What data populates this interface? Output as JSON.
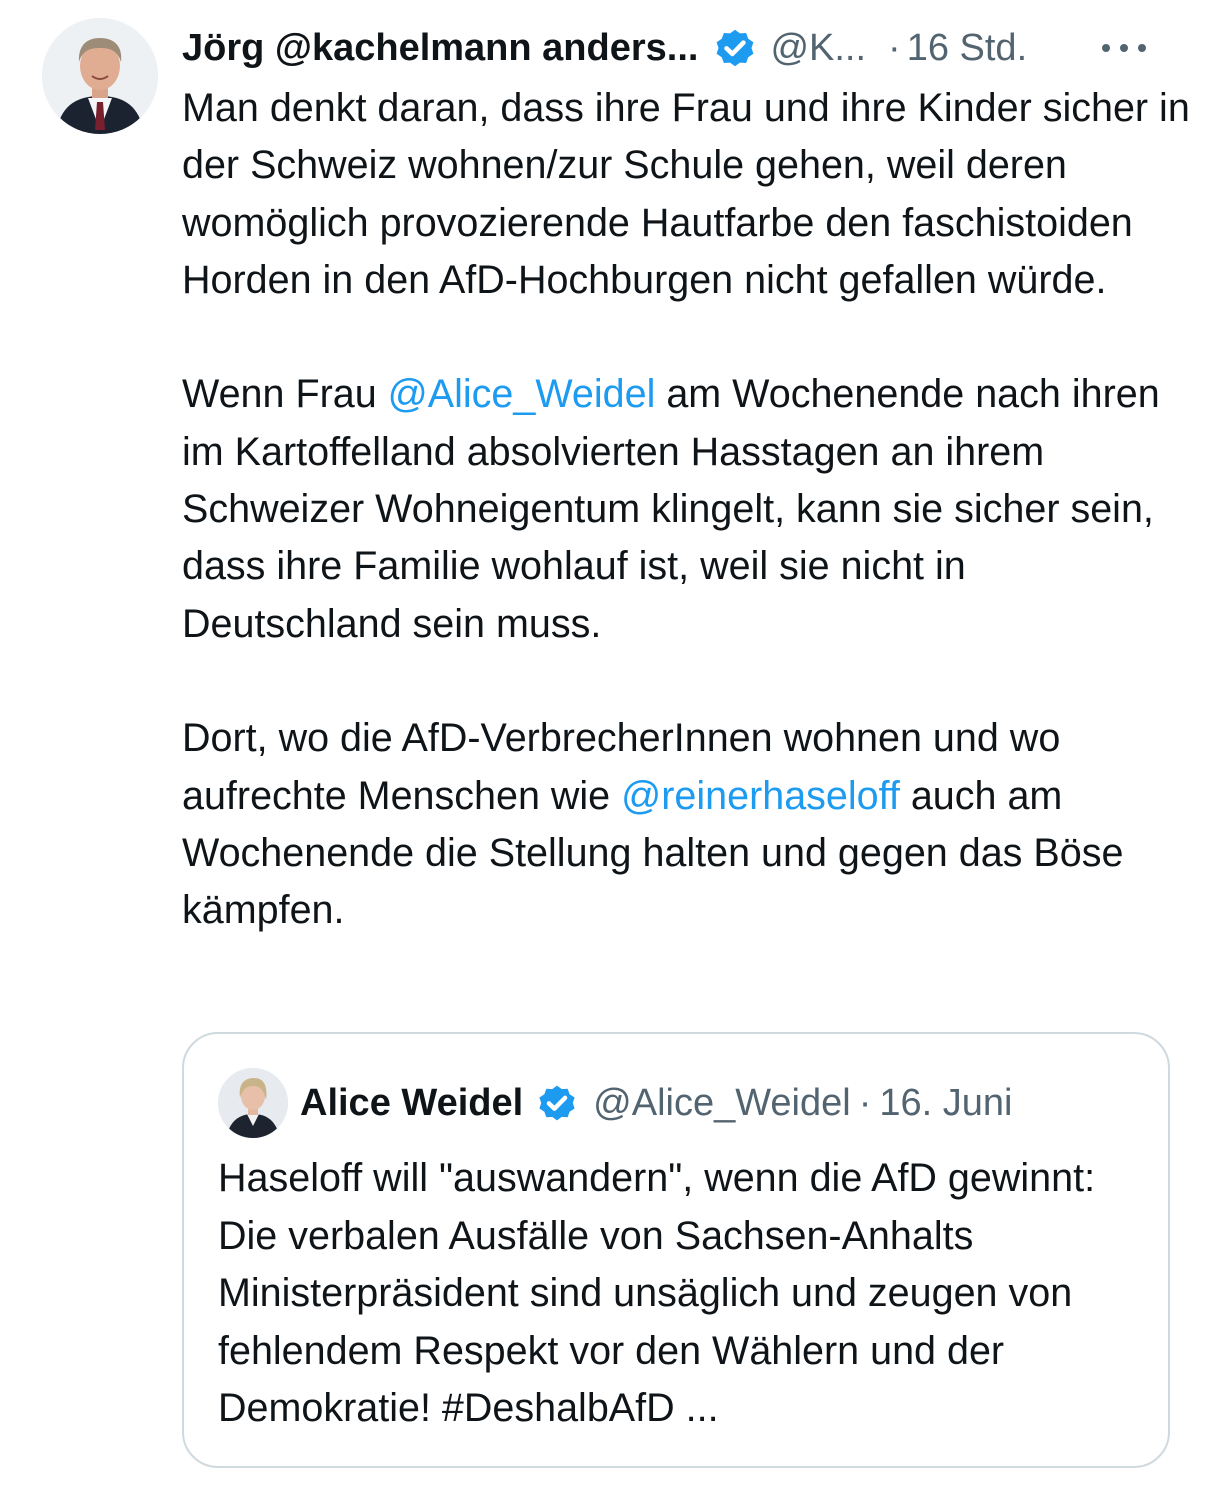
{
  "tweet": {
    "author": {
      "display_name": "Jörg @kachelmann anders...",
      "handle": "@K...",
      "separator": "·",
      "time": "16 Std.",
      "verified": true,
      "avatar_icon": "avatar-icon"
    },
    "more_icon": "more-options-icon",
    "paragraphs": {
      "p1": "Man denkt daran, dass ihre Frau und ihre Kinder sicher in der Schweiz wohnen/zur Schule gehen, weil deren womöglich provozierende Hautfarbe den faschistoiden Horden in den AfD-Hochburgen nicht gefallen würde.",
      "p2_before": "Wenn Frau ",
      "p2_mention": "@Alice_Weidel",
      "p2_after": " am Wochenende nach ihren im Kartoffelland absolvierten Hasstagen an ihrem Schweizer Wohneigentum klingelt, kann sie sicher sein, dass ihre Familie wohlauf ist, weil sie nicht in Deutschland sein muss.",
      "p3_before": "Dort, wo die AfD-VerbrecherInnen wohnen und wo aufrechte Menschen wie ",
      "p3_mention": "@reinerhaseloff",
      "p3_after": " auch am Wochenende die Stellung halten und gegen das Böse kämpfen."
    },
    "quoted": {
      "display_name": "Alice Weidel",
      "handle": "@Alice_Weidel",
      "separator": "·",
      "date": "16. Juni",
      "verified": true,
      "text": "Haseloff will \"auswandern\", wenn die AfD gewinnt: Die verbalen Ausfälle von Sachsen-Anhalts Ministerpräsident sind unsäglich und zeugen von fehlendem Respekt vor den Wählern und der Demokratie! #DeshalbAfD ..."
    }
  },
  "colors": {
    "text": "#0f1419",
    "secondary": "#536471",
    "link": "#1d9bf0",
    "verified_badge": "#1d9bf0",
    "border": "#cfd9de"
  }
}
